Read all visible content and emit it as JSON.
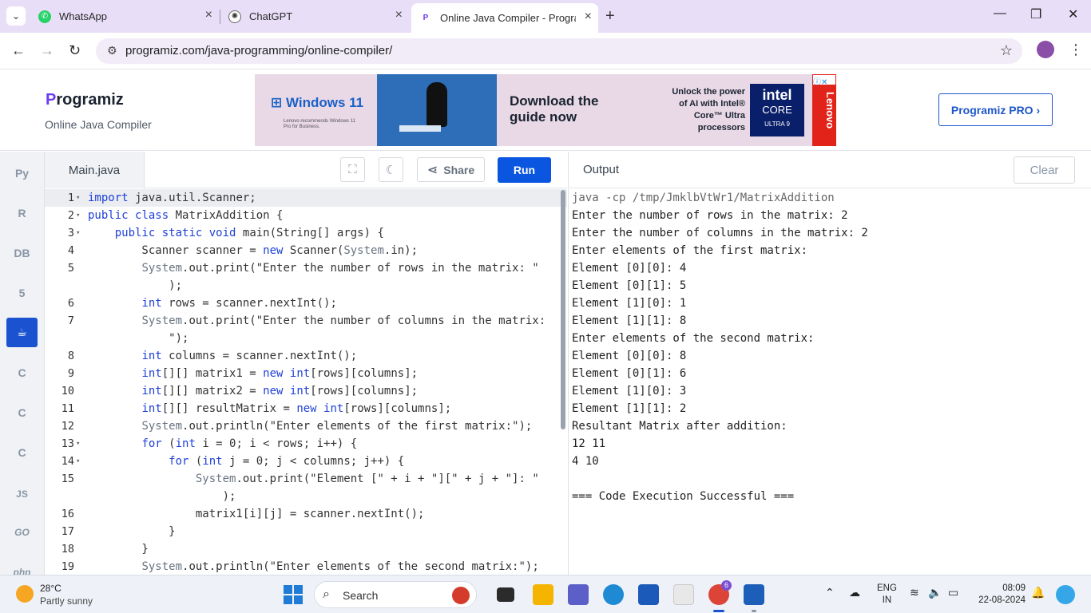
{
  "browser": {
    "tabs": [
      {
        "title": "WhatsApp",
        "icon": "whatsapp-icon",
        "color": "#25d366"
      },
      {
        "title": "ChatGPT",
        "icon": "chatgpt-icon",
        "color": "#333333"
      },
      {
        "title": "Online Java Compiler - Progra",
        "icon": "programiz-icon",
        "color": "#6d3cf0"
      }
    ],
    "url": "programiz.com/java-programming/online-compiler/"
  },
  "site": {
    "logo": "rogramiz",
    "logo_p": "P",
    "subtitle": "Online Java Compiler",
    "pro_button": "Programiz PRO ›",
    "ad": {
      "windows": "Windows 11",
      "windows_sub": "Lenovo recommends Windows 11 Pro for Business.",
      "headline": "Download the guide now",
      "unlock": "Unlock the power of AI with Intel® Core™ Ultra processors",
      "intel": "intel",
      "core": "CORE",
      "ultra": "ULTRA  9",
      "lenovo": "Lenovo"
    }
  },
  "sidebar": {
    "languages": [
      {
        "name": "python-icon",
        "glyph": "Py"
      },
      {
        "name": "r-icon",
        "glyph": "R"
      },
      {
        "name": "sql-icon",
        "glyph": "DB"
      },
      {
        "name": "html-icon",
        "glyph": "5"
      },
      {
        "name": "java-icon",
        "glyph": "☕",
        "active": true
      },
      {
        "name": "c-icon",
        "glyph": "C"
      },
      {
        "name": "cpp-icon",
        "glyph": "C"
      },
      {
        "name": "csharp-icon",
        "glyph": "C"
      },
      {
        "name": "js-icon",
        "glyph": "JS"
      },
      {
        "name": "go-icon",
        "glyph": "GO"
      },
      {
        "name": "php-icon",
        "glyph": "php"
      }
    ]
  },
  "editor": {
    "filename": "Main.java",
    "share_label": "Share",
    "run_label": "Run"
  },
  "code_lines": [
    {
      "n": "1",
      "fold": true,
      "text": "import java.util.Scanner;",
      "hl": true
    },
    {
      "n": "2",
      "fold": true,
      "text": "public class MatrixAddition {"
    },
    {
      "n": "3",
      "fold": true,
      "text": "    public static void main(String[] args) {"
    },
    {
      "n": "4",
      "text": "        Scanner scanner = new Scanner(System.in);"
    },
    {
      "n": "5",
      "text": "        System.out.print(\"Enter the number of rows in the matrix: \""
    },
    {
      "n": "",
      "text": "            );"
    },
    {
      "n": "6",
      "text": "        int rows = scanner.nextInt();"
    },
    {
      "n": "7",
      "text": "        System.out.print(\"Enter the number of columns in the matrix:"
    },
    {
      "n": "",
      "text": "            \");"
    },
    {
      "n": "8",
      "text": "        int columns = scanner.nextInt();"
    },
    {
      "n": "9",
      "text": "        int[][] matrix1 = new int[rows][columns];"
    },
    {
      "n": "10",
      "text": "        int[][] matrix2 = new int[rows][columns];"
    },
    {
      "n": "11",
      "text": "        int[][] resultMatrix = new int[rows][columns];"
    },
    {
      "n": "12",
      "text": "        System.out.println(\"Enter elements of the first matrix:\");"
    },
    {
      "n": "13",
      "fold": true,
      "text": "        for (int i = 0; i < rows; i++) {"
    },
    {
      "n": "14",
      "fold": true,
      "text": "            for (int j = 0; j < columns; j++) {"
    },
    {
      "n": "15",
      "text": "                System.out.print(\"Element [\" + i + \"][\" + j + \"]: \""
    },
    {
      "n": "",
      "text": "                    );"
    },
    {
      "n": "16",
      "text": "                matrix1[i][j] = scanner.nextInt();"
    },
    {
      "n": "17",
      "text": "            }"
    },
    {
      "n": "18",
      "text": "        }"
    },
    {
      "n": "19",
      "text": "        System.out.println(\"Enter elements of the second matrix:\");"
    }
  ],
  "output": {
    "title": "Output",
    "clear_label": "Clear",
    "lines": [
      "java -cp /tmp/JmklbVtWr1/MatrixAddition",
      "Enter the number of rows in the matrix: 2",
      "Enter the number of columns in the matrix: 2",
      "Enter elements of the first matrix:",
      "Element [0][0]: 4",
      "Element [0][1]: 5",
      "Element [1][0]: 1",
      "Element [1][1]: 8",
      "Enter elements of the second matrix:",
      "Element [0][0]: 8",
      "Element [0][1]: 6",
      "Element [1][0]: 3",
      "Element [1][1]: 2",
      "Resultant Matrix after addition:",
      "12 11",
      "4 10",
      "",
      "=== Code Execution Successful ==="
    ]
  },
  "taskbar": {
    "temperature": "28°C",
    "weather": "Partly sunny",
    "search_label": "Search",
    "lang": "ENG",
    "region": "IN",
    "time": "08:09",
    "date": "22-08-2024",
    "notification_count": "6"
  }
}
